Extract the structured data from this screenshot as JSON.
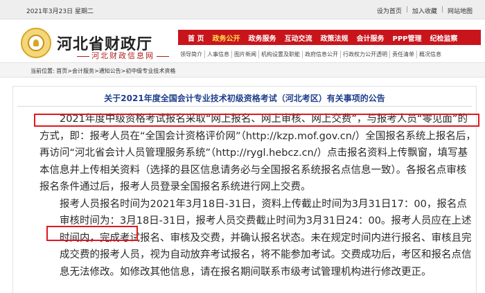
{
  "topbar": {
    "date": "2021年3月23日  星期二",
    "links": [
      "设为首页",
      "加入收藏",
      "网站地图"
    ]
  },
  "header": {
    "site_name": "河北省财政厅",
    "site_sub": "河北财政信息网",
    "nav_main": [
      "首  页",
      "政务公开",
      "政务服务",
      "互动交流",
      "政策法规",
      "会计服务",
      "PPP管理",
      "纪检监察"
    ],
    "nav_main_active": 1,
    "nav_sub": [
      "领导简介",
      "人事信息",
      "图片新闻",
      "机构设置及职能",
      "政府信息公开",
      "行政权力公开透明",
      "责任清单",
      "概况信息"
    ]
  },
  "breadcrumb": "当前位置: 首页>会计服务>通知公告>初中级专业技术资格",
  "article": {
    "title": "关于2021年度全国会计专业技术初级资格考试（河北考区）有关事项的公告",
    "p1_line1": "2021年度中级资格考试报名采取“网上报名、网上审核、网上交费”，与报考人员“零见面”的",
    "p1_rest": "方式，即：报考人员在“全国会计资格评价网”（http://kzp.mof.gov.cn/）全国报名系统上报名后，再访问“河北省会计人员管理服务系统”（http://rygl.hebcz.cn/）点击报名资料上传飘窗，填写基本信息并上传相关资料（选择的县区信息请务必与全国报名系统报名点信息一致）。各报名点审核报名条件通过后，报考人员登录全国报名系统进行网上交费。",
    "p2_a": "报考人员报名时间为2021年3月18日-31日，资料上传截止时间为3月31日17：00，报名点审核时间为：",
    "p2_highlight": "3月18日-31日",
    "p2_b": "，报考人员交费截止时间为3月31日24：00。报考人员应在上述时间内，完成考试报名、审核及交费，并确认报名状态。未在规定时间内进行报名、审核且完成交费的报考人员，视为自动放弃考试报名，将不能参加考试。交费成功后，考区和报名点信息无法修改。如修改其他信息，请在报名期间联系市级考试管理机构进行修改更正。"
  },
  "colors": {
    "nav_red": "#c8151c",
    "nav_active": "#ffe14b",
    "title_blue": "#1f3f8c",
    "highlight_red": "#e0171f"
  }
}
